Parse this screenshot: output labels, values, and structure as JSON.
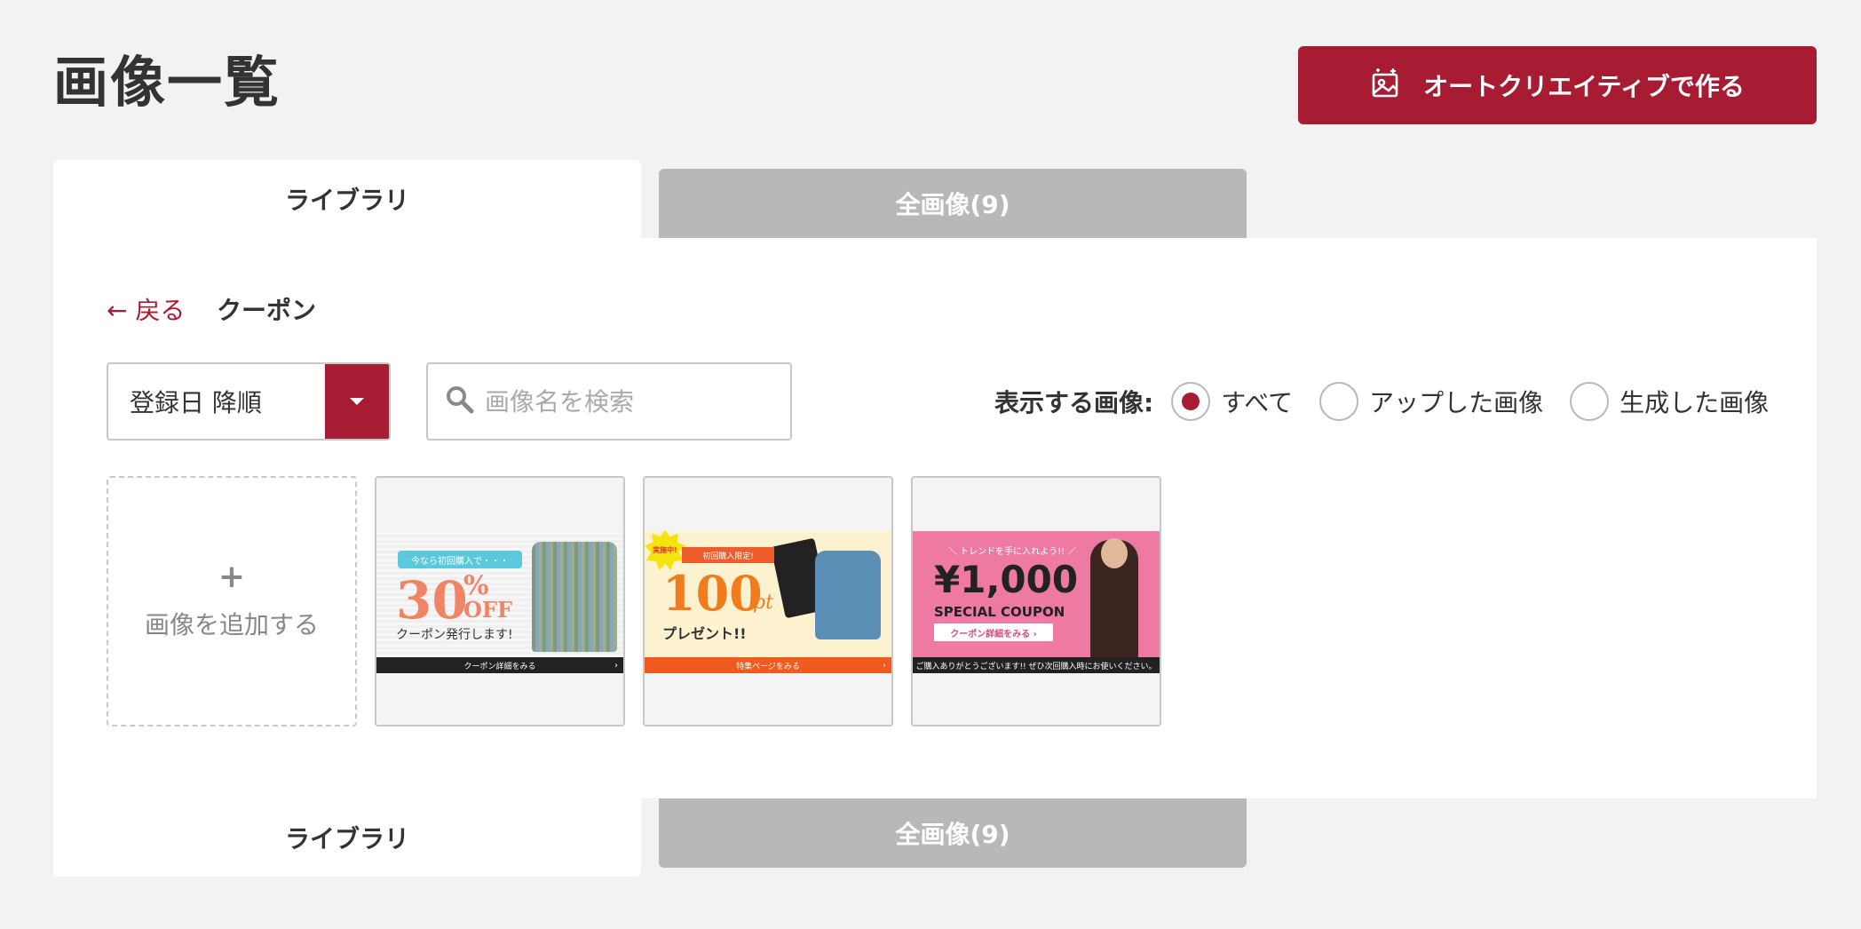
{
  "header": {
    "title": "画像一覧",
    "auto_button_label": "オートクリエイティブで作る",
    "auto_button_icon": "image-sparkle-icon"
  },
  "tabs": [
    {
      "label": "ライブラリ",
      "active": true
    },
    {
      "label": "全画像(9)",
      "active": false
    }
  ],
  "breadcrumb": {
    "back_label": "← 戻る",
    "current": "クーポン"
  },
  "controls": {
    "sort_value": "登録日 降順",
    "search_placeholder": "画像名を検索",
    "filter_label": "表示する画像:",
    "filter_options": [
      {
        "label": "すべて",
        "checked": true
      },
      {
        "label": "アップした画像",
        "checked": false
      },
      {
        "label": "生成した画像",
        "checked": false
      }
    ]
  },
  "colors": {
    "accent": "#a71c33",
    "tab_inactive": "#b8b8b8",
    "background": "#f2f2f2"
  },
  "add_tile": {
    "plus": "+",
    "label": "画像を追加する"
  },
  "images": [
    {
      "pill": "今なら初回購入で・・・",
      "big": "30",
      "pct": "%",
      "off": "OFF",
      "sub": "クーポン発行します!",
      "bar": "クーポン詳細をみる",
      "chev": "›"
    },
    {
      "burst": "実施中!",
      "ribbon": "初回購入限定!",
      "big": "100",
      "pt": "pt",
      "sub": "プレゼント!!",
      "bar": "特集ページをみる",
      "chev": "›"
    },
    {
      "tag": "＼ トレンドを手に入れよう!! ／",
      "big": "¥1,000",
      "sub": "SPECIAL COUPON",
      "btn": "クーポン詳細をみる ›",
      "bar": "ご購入ありがとうございます!! ぜひ次回購入時にお使いください。"
    }
  ]
}
